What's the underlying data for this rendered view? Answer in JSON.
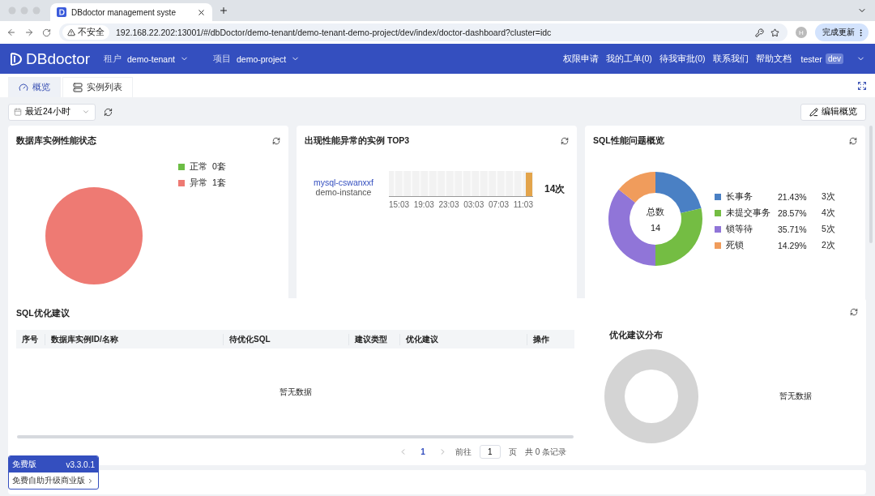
{
  "browser": {
    "tab_title": "DBdoctor management syste",
    "security_label": "不安全",
    "url": "192.168.22.202:13001/#/dbDoctor/demo-tenant/demo-tenant-demo-project/dev/index/doctor-dashboard?cluster=idc",
    "profile_initial": "H",
    "update_button": "完成更新"
  },
  "header": {
    "logo": "DBdoctor",
    "tenant_label": "租户",
    "tenant": "demo-tenant",
    "project_label": "项目",
    "project": "demo-project",
    "links": [
      "权限申请",
      "我的工单(0)",
      "待我审批(0)",
      "联系我们",
      "帮助文档"
    ],
    "user": "tester",
    "user_badge": "dev"
  },
  "tabs": [
    {
      "label": "概览",
      "selected": true,
      "kind": "gauge"
    },
    {
      "label": "实例列表",
      "selected": false,
      "kind": "server"
    }
  ],
  "toolbar": {
    "time_range": "最近24小时",
    "edit_button": "编辑概览"
  },
  "status_card": {
    "title": "数据库实例性能状态",
    "legend": [
      {
        "count": "0套",
        "color": "#6cbd45"
      },
      {
        "count": "1套",
        "color": "#ee7a73"
      }
    ],
    "chart_data": {
      "type": "pie",
      "categories": [
        "正常",
        "异常"
      ],
      "values": [
        0,
        1
      ]
    }
  },
  "top3_card": {
    "title": "出现性能异常的实例 TOP3",
    "instances": [
      {
        "name": "mysql-cswanxxf",
        "description": "demo-instance",
        "count": "14次"
      }
    ],
    "time_labels": [
      "15:03",
      "19:03",
      "23:03",
      "03:03",
      "07:03",
      "11:03"
    ]
  },
  "sql_card": {
    "title": "SQL性能问题概览",
    "center_label": "总数",
    "center_value": "14",
    "legend": [
      {
        "count": "3次",
        "color": "#4a80c4"
      },
      {
        "count": "4次",
        "color": "#74bd43"
      },
      {
        "count": "5次",
        "color": "#9075d8"
      },
      {
        "count": "2次",
        "color": "#f09c5c"
      }
    ],
    "chart_data": {
      "type": "donut",
      "categories": [
        "长事务",
        "未提交事务",
        "锁等待",
        "死锁"
      ],
      "values": [
        21.43,
        28.57,
        35.71,
        14.29
      ],
      "value_labels": [
        "21.43%",
        "28.57%",
        "35.71%",
        "14.29%"
      ]
    }
  },
  "optimization_card": {
    "title": "SQL优化建议",
    "columns": [
      "序号",
      "数据库实例ID/名称",
      "待优化SQL",
      "建议类型",
      "优化建议",
      "操作"
    ],
    "empty_text": "暂无数据",
    "pagination": {
      "pages": [
        {
          "label": "1",
          "selected": true
        }
      ],
      "goto_label": "前往",
      "page_input": "1",
      "page_suffix": "页",
      "total": "共 0 条记录"
    },
    "distribution_title": "优化建议分布",
    "distribution_empty": "暂无数据"
  },
  "version_badge": {
    "edition": "免费版",
    "version": "v3.3.0.1",
    "upgrade": "免费自助升级商业版"
  }
}
